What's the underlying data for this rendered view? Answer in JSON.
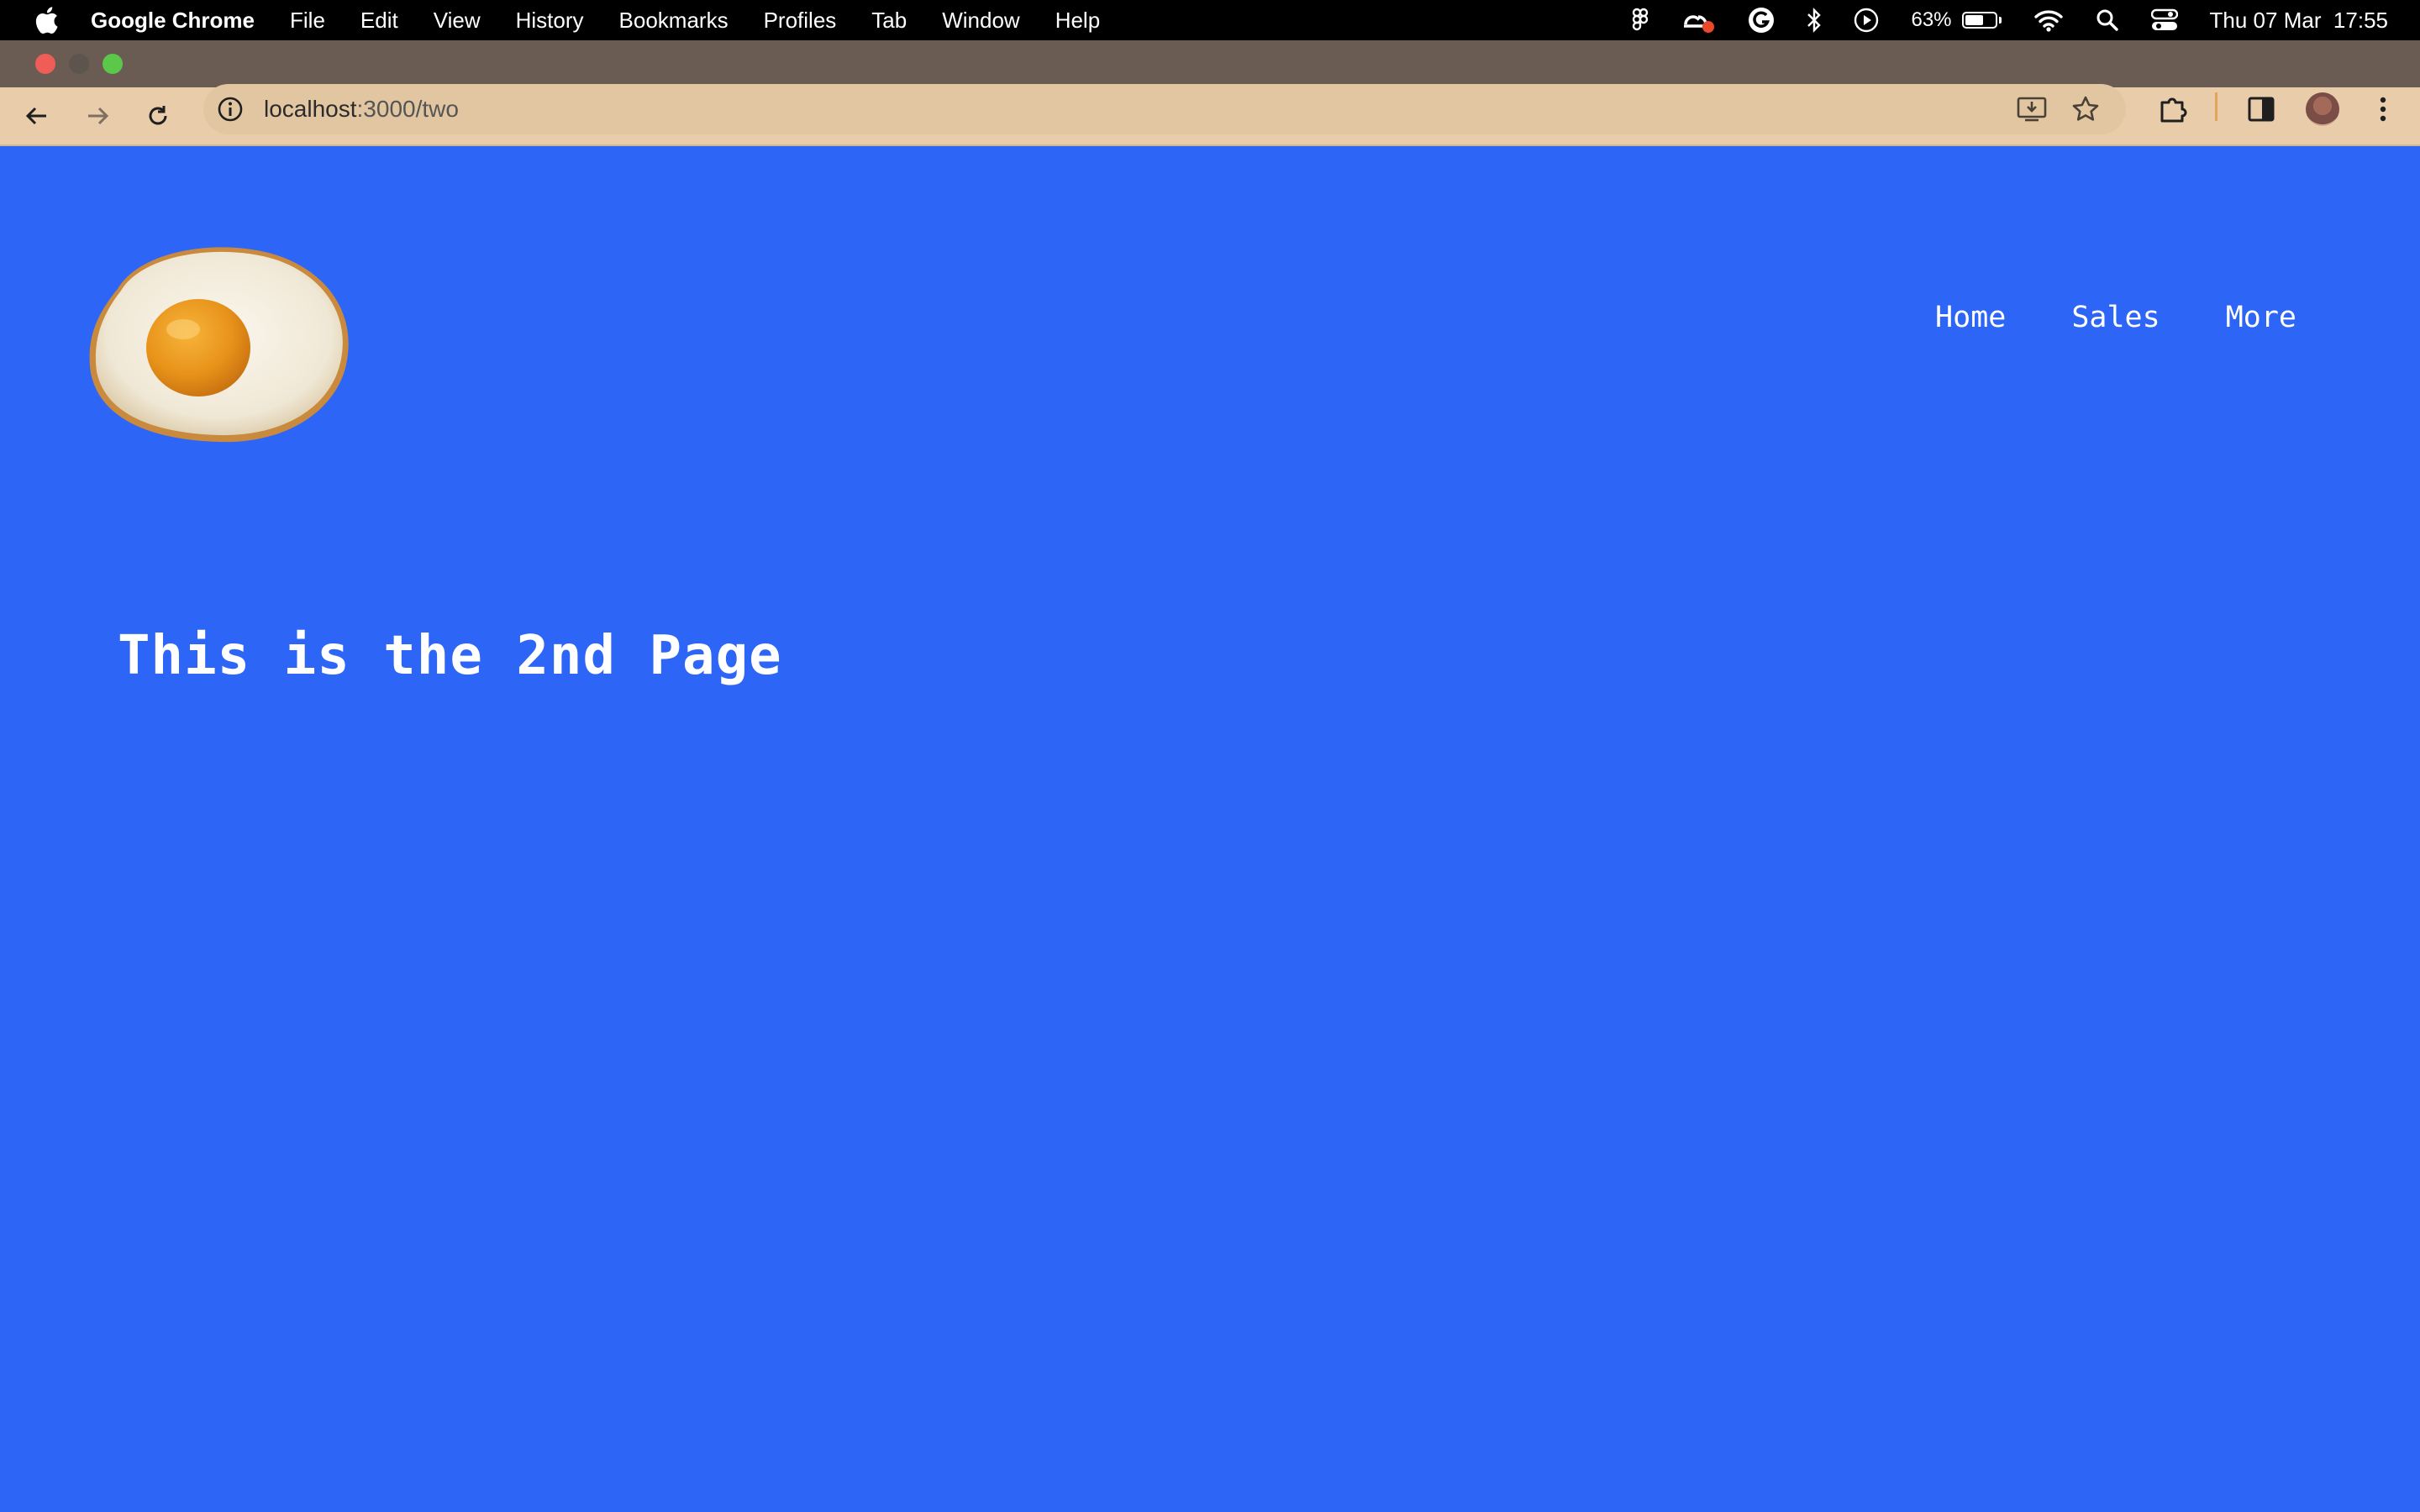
{
  "menubar": {
    "app_name": "Google Chrome",
    "menus": [
      "File",
      "Edit",
      "View",
      "History",
      "Bookmarks",
      "Profiles",
      "Tab",
      "Window",
      "Help"
    ],
    "battery_percent_label": "63%",
    "battery_level": 0.63,
    "datetime": "Thu 07 Mar  17:55",
    "status_icons": [
      "figma-icon",
      "creative-cloud-icon",
      "grammarly-icon",
      "bluetooth-icon",
      "play-icon",
      "battery-icon",
      "wifi-icon",
      "spotlight-search-icon",
      "control-center-icon"
    ]
  },
  "browser": {
    "url_host": "localhost",
    "url_path": ":3000/two",
    "colors": {
      "toolbar": "#E9CDAA",
      "titlebar": "#6A5C53"
    }
  },
  "page": {
    "background": "#2D66F6",
    "nav": [
      "Home",
      "Sales",
      "More"
    ],
    "heading": "This is the 2nd Page",
    "logo": "fried-egg-image"
  }
}
